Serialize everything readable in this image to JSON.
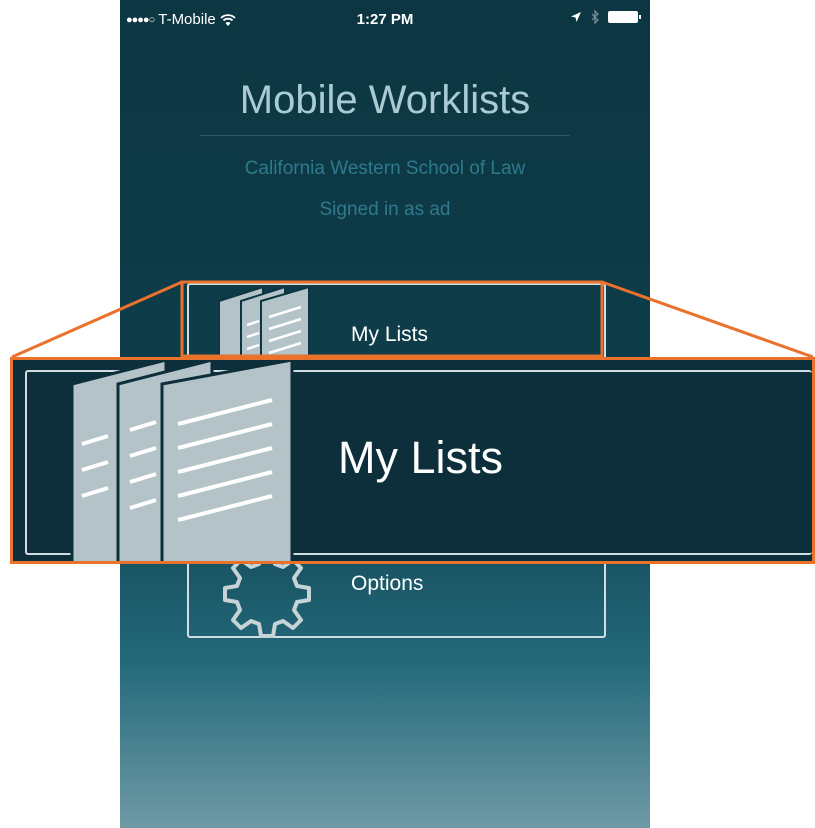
{
  "status_bar": {
    "signal": "●●●●○",
    "carrier": "T-Mobile",
    "time": "1:27 PM"
  },
  "header": {
    "title": "Mobile Worklists",
    "organization": "California Western School of Law",
    "signed_in": "Signed in as ad"
  },
  "menu": {
    "my_lists_label": "My Lists",
    "options_label": "Options"
  },
  "zoom": {
    "label": "My Lists"
  },
  "colors": {
    "accent_outline": "#e9722d",
    "background_top": "#0c3641",
    "icon_fill": "#b4c3c7"
  },
  "icons": [
    "wifi-icon",
    "location-arrow-icon",
    "bluetooth-icon",
    "battery-icon",
    "documents-icon",
    "gear-icon"
  ]
}
